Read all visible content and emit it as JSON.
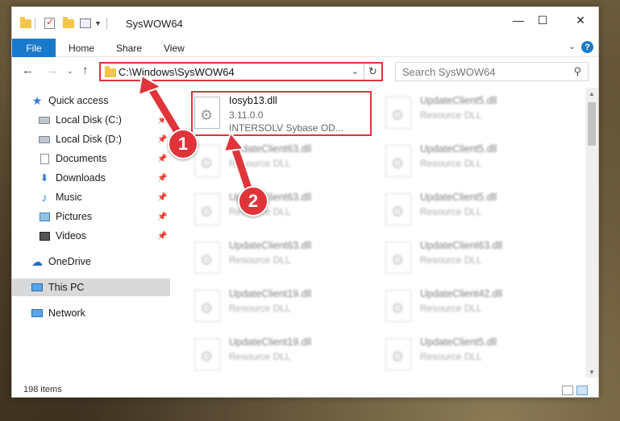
{
  "window": {
    "title": "SysWOW64",
    "controls": {
      "minimize": "—",
      "maximize": "☐",
      "close": "✕"
    }
  },
  "ribbon": {
    "file_tab": "File",
    "tabs": [
      "Home",
      "Share",
      "View"
    ]
  },
  "navigation": {
    "address_path": "C:\\Windows\\SysWOW64",
    "search_placeholder": "Search SysWOW64"
  },
  "sidebar": {
    "items": [
      {
        "label": "Quick access",
        "icon": "star-icon",
        "pinned": false
      },
      {
        "label": "Local Disk (C:)",
        "icon": "drive-icon",
        "pinned": true
      },
      {
        "label": "Local Disk (D:)",
        "icon": "drive-icon",
        "pinned": true
      },
      {
        "label": "Documents",
        "icon": "documents-icon",
        "pinned": true
      },
      {
        "label": "Downloads",
        "icon": "downloads-icon",
        "pinned": true
      },
      {
        "label": "Music",
        "icon": "music-icon",
        "pinned": true
      },
      {
        "label": "Pictures",
        "icon": "pictures-icon",
        "pinned": true
      },
      {
        "label": "Videos",
        "icon": "videos-icon",
        "pinned": true
      },
      {
        "label": "OneDrive",
        "icon": "onedrive-icon",
        "pinned": false
      },
      {
        "label": "This PC",
        "icon": "this-pc-icon",
        "pinned": false,
        "selected": true
      },
      {
        "label": "Network",
        "icon": "network-icon",
        "pinned": false
      }
    ]
  },
  "files": {
    "highlighted": {
      "name": "Iosyb13.dll",
      "version": "3.11.0.0",
      "description": "INTERSOLV Sybase OD..."
    },
    "others": [
      {
        "name": "UpdateClient5.dll",
        "sub": "Resource DLL"
      },
      {
        "name": "UpdateClient63.dll",
        "sub": "Resource DLL"
      },
      {
        "name": "UpdateClient5.dll",
        "sub": "Resource DLL"
      },
      {
        "name": "UpdateClient63.dll",
        "sub": "Resource DLL"
      },
      {
        "name": "UpdateClient5.dll",
        "sub": "Resource DLL"
      },
      {
        "name": "UpdateClient63.dll",
        "sub": "Resource DLL"
      },
      {
        "name": "UpdateClient63.dll",
        "sub": "Resource DLL"
      },
      {
        "name": "UpdateClient19.dll",
        "sub": "Resource DLL"
      },
      {
        "name": "UpdateClient42.dll",
        "sub": "Resource DLL"
      },
      {
        "name": "UpdateClient19.dll",
        "sub": "Resource DLL"
      },
      {
        "name": "UpdateClient5.dll",
        "sub": "Resource DLL"
      }
    ]
  },
  "status": {
    "item_count": "198 items"
  },
  "annotations": {
    "step1": "1",
    "step2": "2"
  },
  "colors": {
    "accent": "#1979ca",
    "highlight": "#e0333a"
  }
}
